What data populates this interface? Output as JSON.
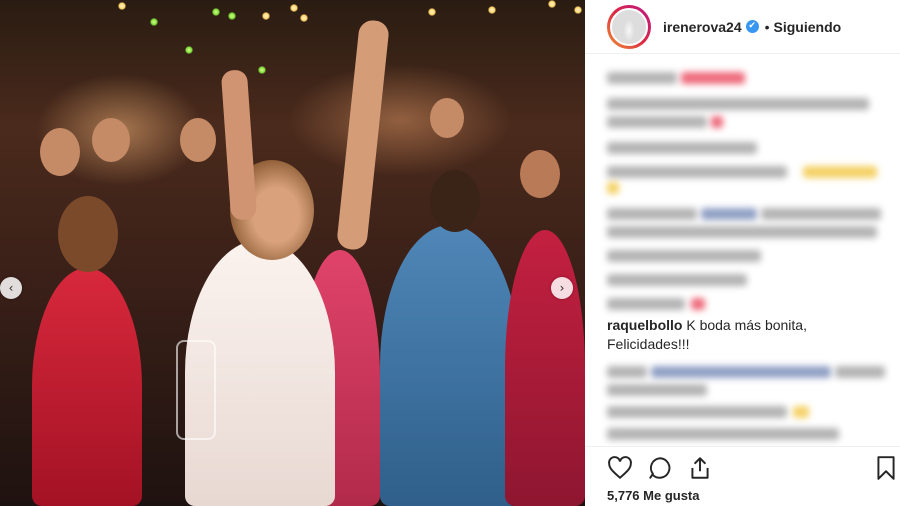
{
  "post": {
    "username": "irenerova24",
    "verified_mark": "✔",
    "separator": "•",
    "follow_state": "Siguiendo",
    "likes_text": "5,776 Me gusta"
  },
  "comment": {
    "username": "raquelbollo",
    "text_line1": " K boda más bonita,",
    "text_line2": "Felicidades!!!"
  },
  "icons": {
    "carousel_prev": "‹",
    "carousel_next": "›",
    "like": "heart-icon",
    "comment": "comment-icon",
    "share": "share-icon",
    "save": "bookmark-icon"
  },
  "colors": {
    "text": "#262626",
    "verified": "#3897f0",
    "divider": "#efefef"
  }
}
